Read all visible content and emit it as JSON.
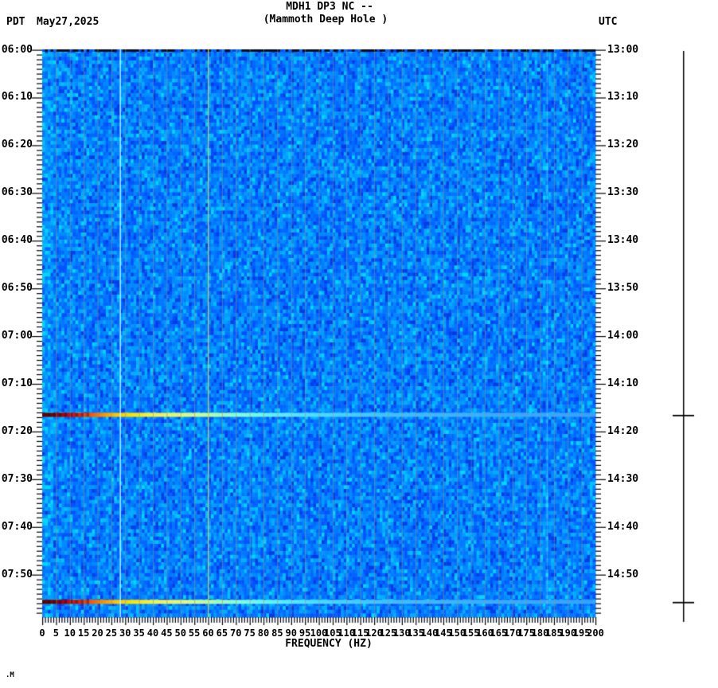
{
  "header": {
    "timezone_left": "PDT",
    "date": "May27,2025",
    "title": "MDH1 DP3 NC --",
    "subtitle": "(Mammoth Deep Hole )",
    "timezone_right": "UTC"
  },
  "footer": {
    "corner_mark": ".M"
  },
  "chart_data": {
    "type": "heatmap",
    "title": "MDH1 DP3 NC --",
    "subtitle": "(Mammoth Deep Hole )",
    "xlabel": "FREQUENCY (HZ)",
    "x_range_hz": [
      0,
      200
    ],
    "x_major_tick_step_hz": 5,
    "x_minor_tick_step_hz": 1,
    "x_tick_labels": [
      "0",
      "5",
      "10",
      "15",
      "20",
      "25",
      "30",
      "35",
      "40",
      "45",
      "50",
      "55",
      "60",
      "65",
      "70",
      "75",
      "80",
      "85",
      "90",
      "95",
      "100",
      "105",
      "110",
      "115",
      "120",
      "125",
      "130",
      "135",
      "140",
      "145",
      "150",
      "155",
      "160",
      "165",
      "170",
      "175",
      "180",
      "185",
      "190",
      "195",
      "200"
    ],
    "y_axis_left": {
      "timezone": "PDT",
      "date": "May27,2025",
      "tick_labels": [
        "06:00",
        "06:10",
        "06:20",
        "06:30",
        "06:40",
        "06:50",
        "07:00",
        "07:10",
        "07:20",
        "07:30",
        "07:40",
        "07:50"
      ]
    },
    "y_axis_right": {
      "timezone": "UTC",
      "tick_labels": [
        "13:00",
        "13:10",
        "13:20",
        "13:30",
        "13:40",
        "13:50",
        "14:00",
        "14:10",
        "14:20",
        "14:30",
        "14:40",
        "14:50"
      ]
    },
    "y_minor_tick_minutes": 1,
    "y_major_tick_minutes": 10,
    "y_span_minutes": 119,
    "grid": {
      "vertical_gridline_step_hz": 5,
      "gridline_color": "rgba(146,146,118,0.55)"
    },
    "noise_palette": [
      "#003ce8",
      "#0052ff",
      "#0066ff",
      "#0078ff",
      "#008aff",
      "#009cff",
      "#00aeff",
      "#00c2ff",
      "#00d8ff"
    ],
    "noise_palette_weights": [
      0.07,
      0.13,
      0.17,
      0.19,
      0.16,
      0.12,
      0.09,
      0.05,
      0.02
    ],
    "persistent_lines": [
      {
        "hz": 28.2,
        "color": "#c4ffff",
        "opacity": 0.9,
        "note": "narrowband tone"
      },
      {
        "hz": 60,
        "color": "#d0dc5c",
        "opacity": 0.75,
        "note": "60 Hz mains hum"
      },
      {
        "hz": 182.5,
        "color": "#90e0ff",
        "opacity": 0.35,
        "note": "faint tone"
      }
    ],
    "events": [
      {
        "time_pdt": "07:16",
        "time_utc": "14:16",
        "minutes_from_start": 76.6,
        "type": "broadband event streak"
      },
      {
        "time_pdt": "07:56",
        "time_utc": "14:56",
        "minutes_from_start": 115.8,
        "type": "broadband event streak"
      }
    ],
    "event_gradient_stops": [
      [
        0.0,
        "#600000"
      ],
      [
        0.02,
        "#8c0000"
      ],
      [
        0.04,
        "#c00000"
      ],
      [
        0.06,
        "#e81800"
      ],
      [
        0.08,
        "#ff4400"
      ],
      [
        0.105,
        "#ff8800"
      ],
      [
        0.13,
        "#ffc400"
      ],
      [
        0.16,
        "#ffe400"
      ],
      [
        0.2,
        "#f8f050"
      ],
      [
        0.25,
        "#e4fa78"
      ],
      [
        0.3,
        "#b8ffa0"
      ],
      [
        0.35,
        "#8affd0"
      ],
      [
        0.42,
        "#60f0f4"
      ],
      [
        0.5,
        "#4fd8ff"
      ],
      [
        0.62,
        "#44c0ff"
      ],
      [
        0.8,
        "#3cadff"
      ],
      [
        1.0,
        "#38a2ff"
      ]
    ],
    "event_stripe_range_hz": [
      2,
      16
    ],
    "marker_axis": {
      "side": "right",
      "tick_count": 2
    }
  }
}
